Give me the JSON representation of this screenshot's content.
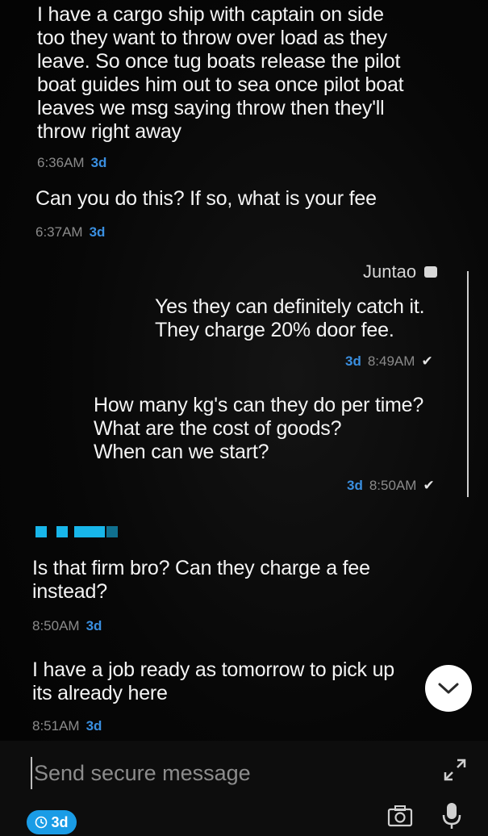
{
  "conversation": {
    "messages": [
      {
        "direction": "received",
        "text": "I have a cargo ship with captain on side\ntoo they want to throw over load as they\nleave. So once tug boats release the pilot\nboat guides him out to sea once pilot boat\nleaves we msg saying throw then they'll\nthrow right away",
        "time": "6:36AM",
        "ago": "3d"
      },
      {
        "direction": "received",
        "text": "Can you do this? If so, what is your fee",
        "time": "6:37AM",
        "ago": "3d"
      },
      {
        "direction": "sent",
        "sender": "Juntao",
        "text": "Yes they can definitely catch it.\nThey charge 20% door fee.",
        "time": "8:49AM",
        "ago": "3d",
        "status": "✔"
      },
      {
        "direction": "sent",
        "text": "How many kg's can they do per time?\nWhat are the cost of goods?\nWhen can we start?",
        "time": "8:50AM",
        "ago": "3d",
        "status": "✔"
      },
      {
        "direction": "received",
        "text": "Is that firm bro? Can they charge a fee\ninstead?",
        "time": "8:50AM",
        "ago": "3d"
      },
      {
        "direction": "received",
        "text": "I have a job ready as tomorrow to pick up\nits already here",
        "time": "8:51AM",
        "ago": "3d"
      }
    ],
    "redacted_name_color": "#18b6ea"
  },
  "composer": {
    "placeholder": "Send secure message",
    "timer_label": "3d",
    "timer_icon": "clock-icon",
    "camera_icon": "camera-icon",
    "mic_icon": "microphone-icon",
    "expand_icon": "expand-icon"
  },
  "scroll_button_icon": "chevron-down-icon",
  "colors": {
    "accent": "#1a9ce6",
    "timestamp": "#8a8a8a",
    "background": "#050505"
  }
}
